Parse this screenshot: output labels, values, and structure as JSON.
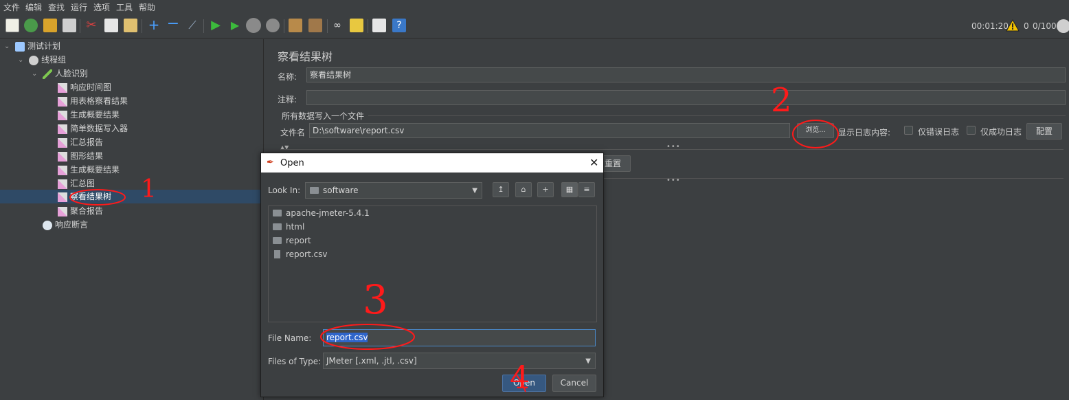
{
  "menubar": {
    "items": [
      "文件",
      "编辑",
      "查找",
      "运行",
      "选项",
      "工具",
      "帮助"
    ]
  },
  "toolbar": {
    "timer": "00:01:20",
    "warning_count": "0",
    "threads": "0/100"
  },
  "tree": {
    "root": "测试计划",
    "thread_group": "线程组",
    "sampler": "人脸识别",
    "listeners": [
      "响应时间图",
      "用表格察看结果",
      "生成概要结果",
      "简单数据写入器",
      "汇总报告",
      "图形结果",
      "生成概要结果",
      "汇总图",
      "察看结果树",
      "聚合报告"
    ],
    "assertion": "响应断言"
  },
  "panel": {
    "title": "察看结果树",
    "name_label": "名称:",
    "name_value": "察看结果树",
    "comment_label": "注释:",
    "comment_value": "",
    "section_label": "所有数据写入一个文件",
    "filename_label": "文件名",
    "filename_value": "D:\\software\\report.csv",
    "browse_label": "浏览...",
    "log_label": "显示日志内容:",
    "errors_only": "仅错误日志",
    "success_only": "仅成功日志",
    "configure": "配置",
    "reset": "重置"
  },
  "dialog": {
    "title": "Open",
    "look_in_label": "Look In:",
    "look_in_value": "software",
    "files": [
      {
        "name": "apache-jmeter-5.4.1",
        "type": "folder"
      },
      {
        "name": "html",
        "type": "folder"
      },
      {
        "name": "report",
        "type": "folder"
      },
      {
        "name": "report.csv",
        "type": "file"
      }
    ],
    "file_name_label": "File Name:",
    "file_name_value": "report.csv",
    "files_of_type_label": "Files of Type:",
    "files_of_type_value": "JMeter [.xml, .jtl, .csv]",
    "open_button": "Open",
    "cancel_button": "Cancel"
  },
  "annotations": [
    "1",
    "2",
    "3",
    "4"
  ],
  "colors": {
    "background": "#3c3f41",
    "selection": "#2f4a66",
    "annotation": "#ff1a1a",
    "primary_button": "#365880"
  }
}
